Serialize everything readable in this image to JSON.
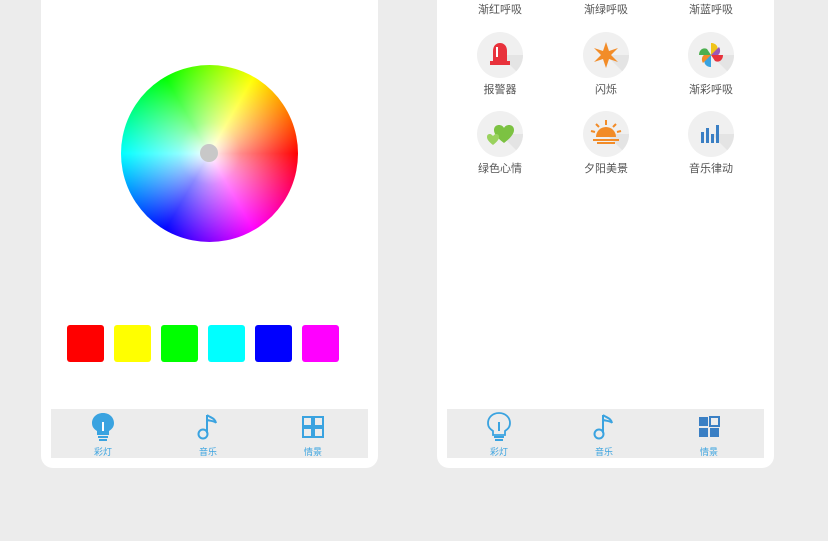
{
  "left_screen": {
    "swatches": [
      {
        "name": "red",
        "color": "#ff0000"
      },
      {
        "name": "yellow",
        "color": "#ffff00"
      },
      {
        "name": "green",
        "color": "#00ff00"
      },
      {
        "name": "cyan",
        "color": "#00ffff"
      },
      {
        "name": "blue",
        "color": "#0000ff"
      },
      {
        "name": "magenta",
        "color": "#ff00ff"
      }
    ],
    "tabs": [
      {
        "label": "彩灯",
        "icon": "bulb-icon",
        "active": true
      },
      {
        "label": "音乐",
        "icon": "music-note-icon",
        "active": false
      },
      {
        "label": "情景",
        "icon": "grid-icon",
        "active": false
      }
    ]
  },
  "right_screen": {
    "top_labels": [
      "渐红呼吸",
      "渐绿呼吸",
      "渐蓝呼吸"
    ],
    "scenes": [
      {
        "label": "报警器",
        "icon": "alarm-siren-icon"
      },
      {
        "label": "闪烁",
        "icon": "flash-star-icon"
      },
      {
        "label": "渐彩呼吸",
        "icon": "pinwheel-icon"
      },
      {
        "label": "绿色心情",
        "icon": "green-hearts-icon"
      },
      {
        "label": "夕阳美景",
        "icon": "sunset-icon"
      },
      {
        "label": "音乐律动",
        "icon": "equalizer-icon"
      }
    ],
    "tabs": [
      {
        "label": "彩灯",
        "icon": "bulb-icon",
        "active": false
      },
      {
        "label": "音乐",
        "icon": "music-note-icon",
        "active": false
      },
      {
        "label": "情景",
        "icon": "grid-icon",
        "active": true
      }
    ]
  },
  "colors": {
    "accent": "#3aa3e0",
    "background": "#ececec",
    "tabbar": "#ececec"
  }
}
